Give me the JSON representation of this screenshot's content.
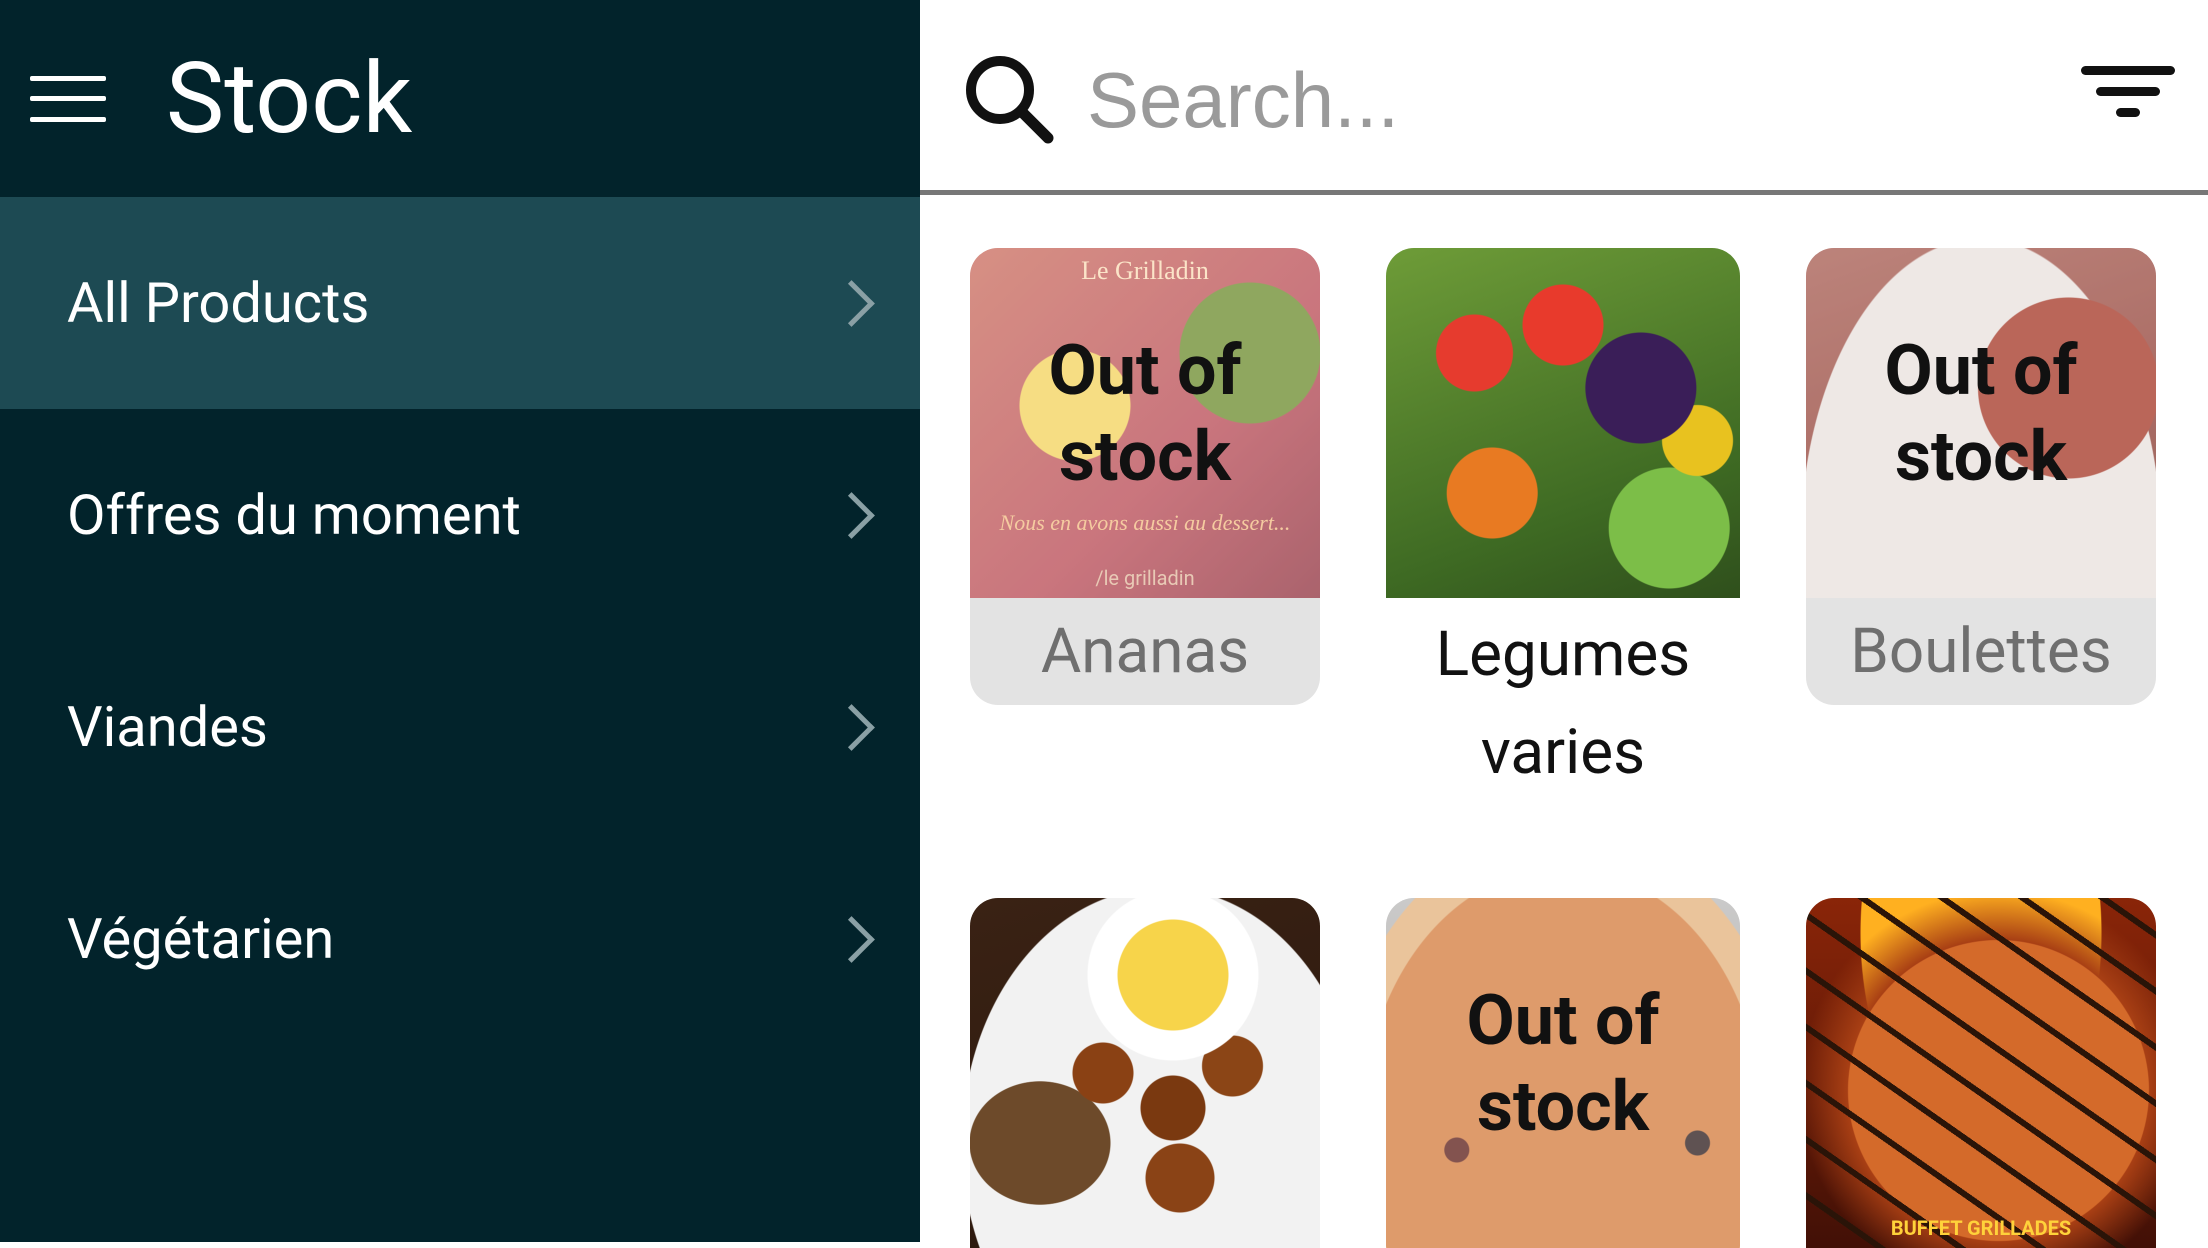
{
  "header": {
    "title": "Stock"
  },
  "sidebar": {
    "items": [
      {
        "label": "All Products",
        "active": true
      },
      {
        "label": "Offres du moment",
        "active": false
      },
      {
        "label": "Viandes",
        "active": false
      },
      {
        "label": "Végétarien",
        "active": false
      }
    ]
  },
  "search": {
    "placeholder": "Search...",
    "value": ""
  },
  "products": [
    {
      "name": "Ananas",
      "status": "Out of stock",
      "image_caption": "Le Grilladin",
      "image_sub": "Nous en avons aussi au dessert...",
      "image_tag": "/le grilladin"
    },
    {
      "name": "Legumes varies",
      "status": ""
    },
    {
      "name": "Boulettes",
      "status": "Out of stock"
    },
    {
      "name": "",
      "status": ""
    },
    {
      "name": "",
      "status": "Out of stock"
    },
    {
      "name": "",
      "status": "",
      "image_tag": "BUFFET GRILLADES"
    }
  ],
  "colors": {
    "sidebar_bg": "#02232b",
    "sidebar_active": "#1d4a53",
    "out_of_stock_bg": "#e3e3e3"
  }
}
